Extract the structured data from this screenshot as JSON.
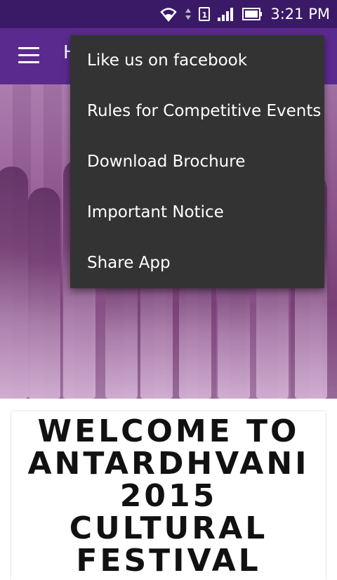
{
  "status_bar": {
    "time": "3:21 PM",
    "sim_label": "1",
    "icons": [
      "wifi-icon",
      "sim-icon",
      "signal-icon",
      "battery-icon"
    ]
  },
  "app_bar": {
    "title": "H",
    "menu_icon": "hamburger-menu-icon",
    "background": "#5b2a8e"
  },
  "overflow_menu": {
    "items": [
      {
        "label": "Like us on facebook"
      },
      {
        "label": "Rules for Competitive Events"
      },
      {
        "label": "Download Brochure"
      },
      {
        "label": "Important Notice"
      },
      {
        "label": "Share App"
      }
    ]
  },
  "welcome_card": {
    "lines": [
      "WELCOME TO",
      "ANTARDHVANI",
      "2015",
      "CULTURAL",
      "FESTIVAL"
    ]
  },
  "colors": {
    "status_bar": "#3a1a66",
    "app_bar": "#5b2a8e",
    "menu_bg": "#333333",
    "menu_text": "#ffffff"
  }
}
